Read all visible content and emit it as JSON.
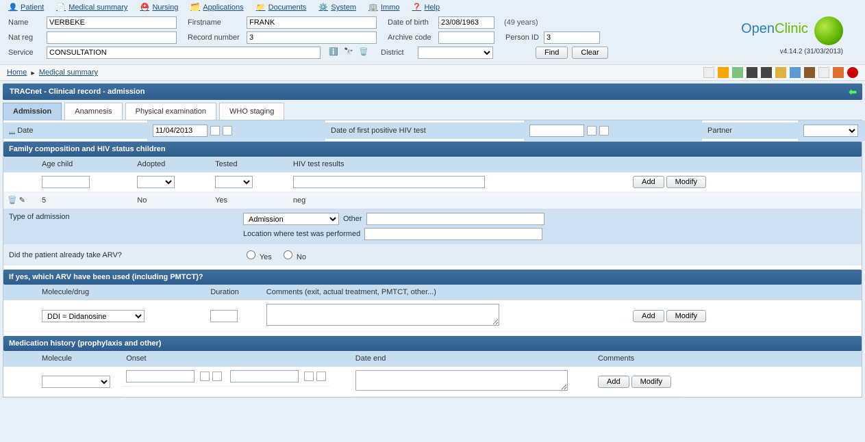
{
  "menu": {
    "patient": "Patient",
    "summary": "Medical summary",
    "nursing": "Nursing",
    "applications": "Applications",
    "documents": "Documents",
    "system": "System",
    "immo": "Immo",
    "help": "Help"
  },
  "patient": {
    "name_label": "Name",
    "name": "VERBEKE",
    "first_label": "Firstname",
    "first": "FRANK",
    "dob_label": "Date of birth",
    "dob": "23/08/1963",
    "age": "(49 years)",
    "natreg_label": "Nat reg",
    "natreg": "",
    "recno_label": "Record number",
    "recno": "3",
    "archive_label": "Archive code",
    "archive": "",
    "pid_label": "Person ID",
    "pid": "3",
    "service_label": "Service",
    "service": "CONSULTATION",
    "district_label": "District",
    "find": "Find",
    "clear": "Clear"
  },
  "brand": {
    "name_a": "Open",
    "name_b": "Clinic",
    "version": "v4.14.2 (31/03/2013)"
  },
  "crumb": {
    "home": "Home",
    "sep": "▸",
    "current": "Medical summary"
  },
  "section_title": "TRACnet - Clinical record - admission",
  "tabs": {
    "admission": "Admission",
    "anamnesis": "Anamnesis",
    "physical": "Physical examination",
    "who": "WHO staging"
  },
  "admission_form": {
    "ellipsis": "...",
    "date_label": "Date",
    "date_value": "11/04/2013",
    "first_hiv_label": "Date of first positive HIV test",
    "first_hiv_value": "",
    "partner_label": "Partner"
  },
  "family": {
    "title": "Family composition and HIV status children",
    "h_age": "Age child",
    "h_adopted": "Adopted",
    "h_tested": "Tested",
    "h_results": "HIV test results",
    "row": {
      "age": "5",
      "adopted": "No",
      "tested": "Yes",
      "results": "neg"
    },
    "add": "Add",
    "modify": "Modify"
  },
  "type_adm": {
    "label": "Type of admission",
    "select": "Admission",
    "other_label": "Other",
    "loc_label": "Location where test was performed"
  },
  "arv_q": {
    "label": "Did the patient already take ARV?",
    "yes": "Yes",
    "no": "No"
  },
  "arv_used": {
    "title": "If yes, which ARV have been used (including PMTCT)?",
    "h_mol": "Molecule/drug",
    "h_dur": "Duration",
    "h_comm": "Comments (exit, actual treatment, PMTCT, other...)",
    "mol_sel": "DDI = Didanosine",
    "add": "Add",
    "modify": "Modify"
  },
  "med_hist": {
    "title": "Medication history (prophylaxis and other)",
    "h_mol": "Molecule",
    "h_onset": "Onset",
    "h_end": "Date end",
    "h_comm": "Comments",
    "add": "Add",
    "modify": "Modify"
  }
}
